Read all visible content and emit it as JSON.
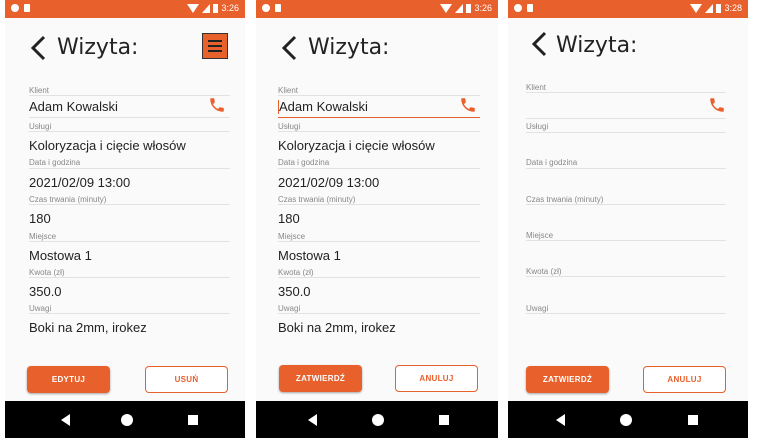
{
  "screens": [
    {
      "time": "3:26",
      "title": "Wizyta:",
      "fields": [
        {
          "label": "Klient",
          "value": "Adam Kowalski"
        },
        {
          "label": "Usługi",
          "value": "Koloryzacja i cięcie włosów"
        },
        {
          "label": "Data i godzina",
          "value": "2021/02/09 13:00"
        },
        {
          "label": "Czas trwania (minuty)",
          "value": "180"
        },
        {
          "label": "Miejsce",
          "value": "Mostowa 1"
        },
        {
          "label": "Kwota (zł)",
          "value": "350.0"
        },
        {
          "label": "Uwagi",
          "value": "Boki na 2mm, irokez"
        }
      ],
      "primary_button": "EDYTUJ",
      "secondary_button": "USUŃ"
    },
    {
      "time": "3:26",
      "title": "Wizyta:",
      "fields": [
        {
          "label": "Klient",
          "value": "Adam Kowalski"
        },
        {
          "label": "Usługi",
          "value": "Koloryzacja i cięcie włosów"
        },
        {
          "label": "Data i godzina",
          "value": "2021/02/09 13:00"
        },
        {
          "label": "Czas trwania (minuty)",
          "value": "180"
        },
        {
          "label": "Miejsce",
          "value": "Mostowa 1"
        },
        {
          "label": "Kwota (zł)",
          "value": "350.0"
        },
        {
          "label": "Uwagi",
          "value": "Boki na 2mm, irokez"
        }
      ],
      "primary_button": "ZATWIERDŹ",
      "secondary_button": "ANULUJ"
    },
    {
      "time": "3:28",
      "title": "Wizyta:",
      "fields": [
        {
          "label": "Klient",
          "value": ""
        },
        {
          "label": "Usługi",
          "value": ""
        },
        {
          "label": "Data i godzina",
          "value": ""
        },
        {
          "label": "Czas trwania (minuty)",
          "value": ""
        },
        {
          "label": "Miejsce",
          "value": ""
        },
        {
          "label": "Kwota (zł)",
          "value": ""
        },
        {
          "label": "Uwagi",
          "value": ""
        }
      ],
      "primary_button": "ZATWIERDŹ",
      "secondary_button": "ANULUJ"
    }
  ],
  "colors": {
    "accent": "#e8602c",
    "navbar": "#000000"
  },
  "icons": [
    "back-arrow-icon",
    "hamburger-menu-icon",
    "phone-icon",
    "nav-back-icon",
    "nav-home-icon",
    "nav-recents-icon"
  ]
}
